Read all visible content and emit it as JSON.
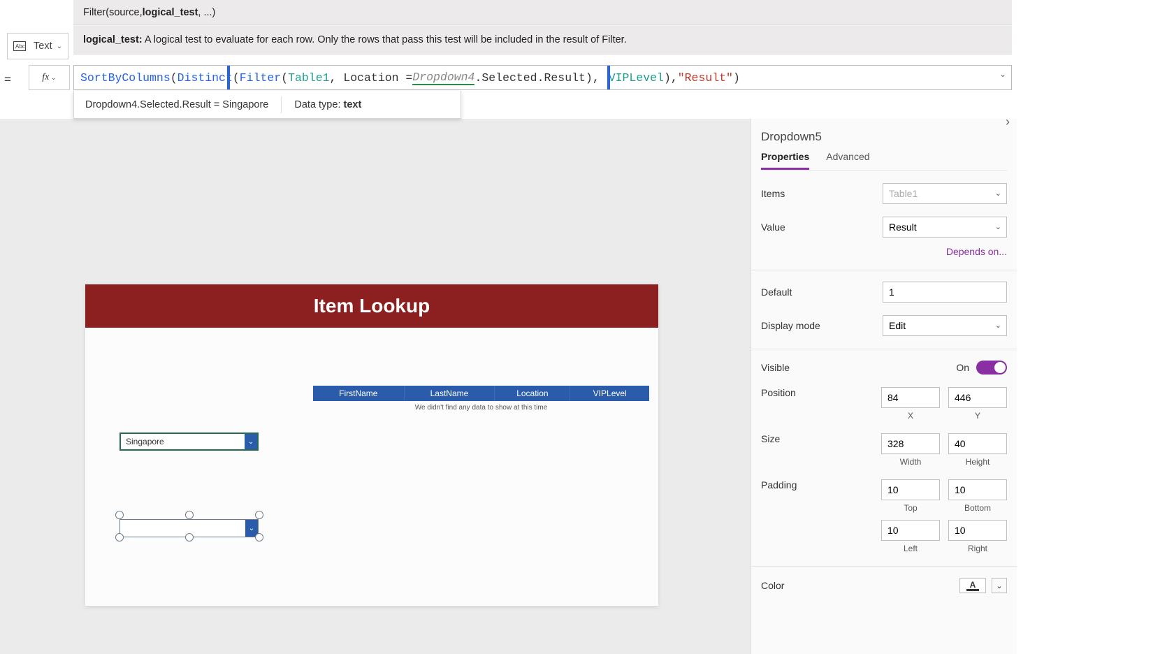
{
  "property_selector": {
    "label": "Text"
  },
  "signature": {
    "fn": "Filter",
    "prefix": "(source, ",
    "active_arg": "logical_test",
    "suffix": ", ...)"
  },
  "hint": {
    "label": "logical_test:",
    "text": " A logical test to evaluate for each row. Only the rows that pass this test will be included in the result of Filter."
  },
  "formula": {
    "p1": "SortByColumns",
    "p2": "(",
    "p3": "Distinct",
    "p4": "(",
    "p5": "Filter",
    "p6": "(",
    "p7": "Table1",
    "p8": ", Location = ",
    "p9": "Dropdown4",
    "p10": ".Selected.Result",
    "p11": ")",
    "p12": ", ",
    "p13": "VIPLevel",
    "p14": "), ",
    "p15": "\"Result\"",
    "p16": ")"
  },
  "eval": {
    "expr": "Dropdown4.Selected.Result  =  Singapore",
    "dt_label": "Data type: ",
    "dt_value": "text"
  },
  "preview": {
    "title": "Item Lookup",
    "columns": [
      "FirstName",
      "LastName",
      "Location",
      "VIPLevel"
    ],
    "empty_msg": "We didn't find any data to show at this time",
    "dropdown1_value": "Singapore",
    "dropdown2_value": ""
  },
  "props": {
    "control_name": "Dropdown5",
    "tabs": {
      "properties": "Properties",
      "advanced": "Advanced"
    },
    "items": {
      "label": "Items",
      "value": "Table1"
    },
    "value": {
      "label": "Value",
      "selected": "Result"
    },
    "depends": "Depends on...",
    "default": {
      "label": "Default",
      "value": "1"
    },
    "display_mode": {
      "label": "Display mode",
      "selected": "Edit"
    },
    "visible": {
      "label": "Visible",
      "state": "On"
    },
    "position": {
      "label": "Position",
      "x": "84",
      "y": "446",
      "xl": "X",
      "yl": "Y"
    },
    "size": {
      "label": "Size",
      "w": "328",
      "h": "40",
      "wl": "Width",
      "hl": "Height"
    },
    "padding": {
      "label": "Padding",
      "t": "10",
      "b": "10",
      "l": "10",
      "r": "10",
      "tl": "Top",
      "bl": "Bottom",
      "ll": "Left",
      "rl": "Right"
    },
    "color": {
      "label": "Color"
    }
  }
}
